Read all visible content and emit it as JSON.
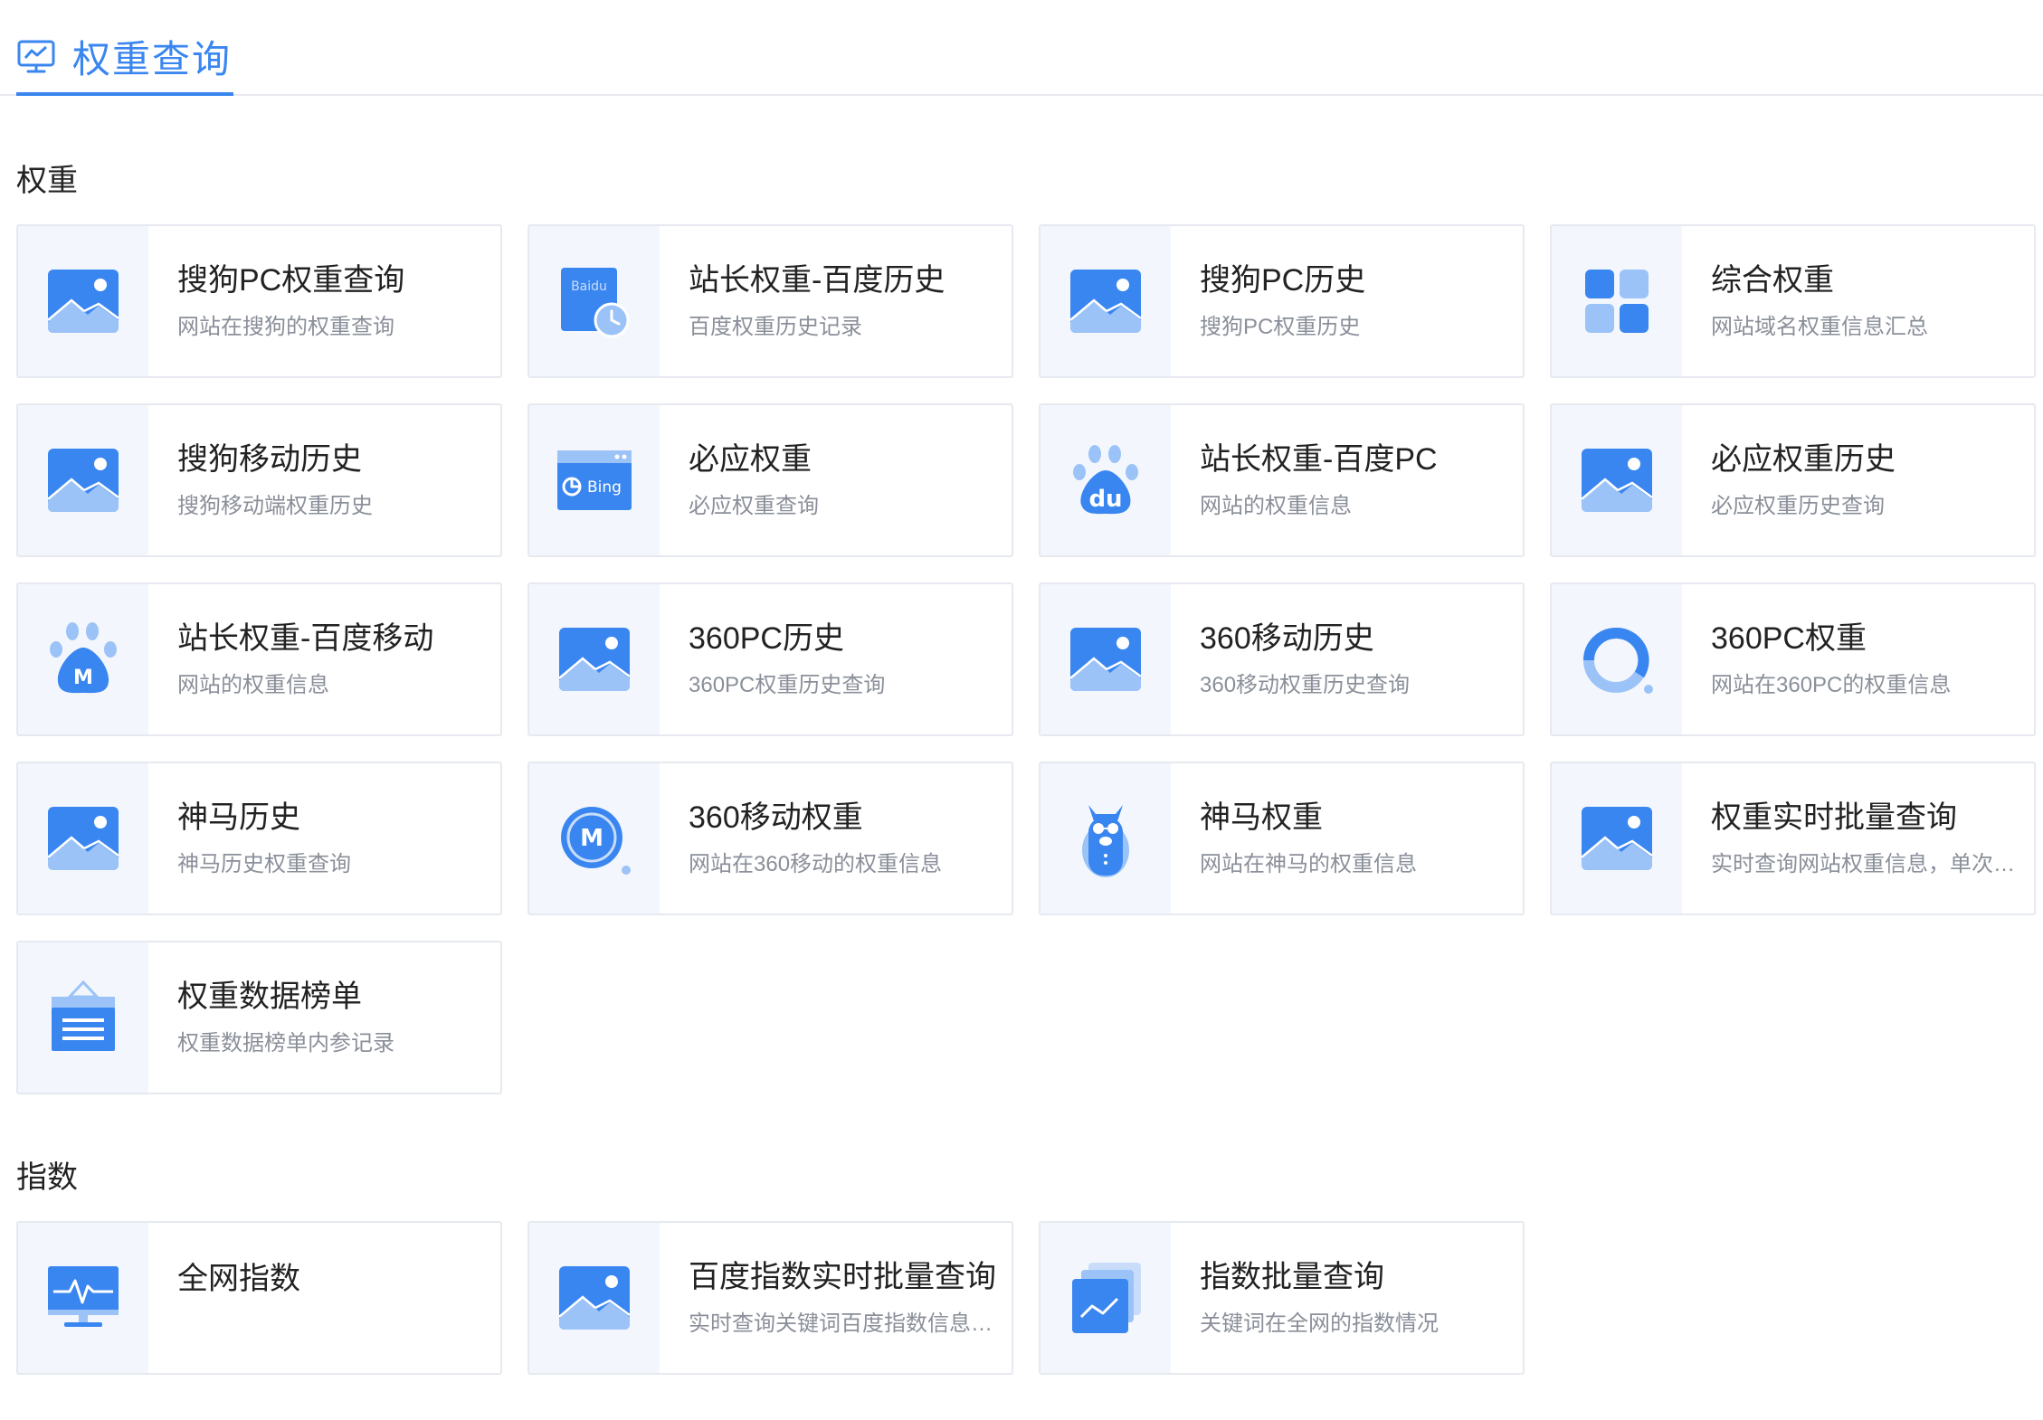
{
  "header": {
    "title": "权重查询",
    "icon": "monitor-chart-icon",
    "accent": "#3a86f0"
  },
  "sections": [
    {
      "title": "权重",
      "cards": [
        {
          "title": "搜狗PC权重查询",
          "desc": "网站在搜狗的权重查询",
          "icon": "image-icon"
        },
        {
          "title": "站长权重-百度历史",
          "desc": "百度权重历史记录",
          "icon": "baidu-history-icon",
          "icon_text": "Baidu"
        },
        {
          "title": "搜狗PC历史",
          "desc": "搜狗PC权重历史",
          "icon": "image-icon"
        },
        {
          "title": "综合权重",
          "desc": "网站域名权重信息汇总",
          "icon": "grid-apps-icon"
        },
        {
          "title": "搜狗移动历史",
          "desc": "搜狗移动端权重历史",
          "icon": "image-icon"
        },
        {
          "title": "必应权重",
          "desc": "必应权重查询",
          "icon": "bing-window-icon",
          "icon_text": "Bing"
        },
        {
          "title": "站长权重-百度PC",
          "desc": "网站的权重信息",
          "icon": "baidu-paw-icon",
          "icon_text": "du"
        },
        {
          "title": "必应权重历史",
          "desc": "必应权重历史查询",
          "icon": "image-icon"
        },
        {
          "title": "站长权重-百度移动",
          "desc": "网站的权重信息",
          "icon": "baidu-mobile-paw-icon",
          "icon_text": "M"
        },
        {
          "title": "360PC历史",
          "desc": "360PC权重历史查询",
          "icon": "image-icon"
        },
        {
          "title": "360移动历史",
          "desc": "360移动权重历史查询",
          "icon": "image-icon"
        },
        {
          "title": "360PC权重",
          "desc": "网站在360PC的权重信息",
          "icon": "360-ring-icon"
        },
        {
          "title": "神马历史",
          "desc": "神马历史权重查询",
          "icon": "image-icon"
        },
        {
          "title": "360移动权重",
          "desc": "网站在360移动的权重信息",
          "icon": "360-mobile-icon",
          "icon_text": "M"
        },
        {
          "title": "神马权重",
          "desc": "网站在神马的权重信息",
          "icon": "shenma-alpaca-icon"
        },
        {
          "title": "权重实时批量查询",
          "desc": "实时查询网站权重信息，单次查询",
          "icon": "image-icon"
        },
        {
          "title": "权重数据榜单",
          "desc": "权重数据榜单内参记录",
          "icon": "ranking-board-icon"
        }
      ]
    },
    {
      "title": "指数",
      "cards": [
        {
          "title": "全网指数",
          "desc": "",
          "icon": "monitor-pulse-icon"
        },
        {
          "title": "百度指数实时批量查询",
          "desc": "实时查询关键词百度指数信息，单次查询",
          "icon": "image-icon"
        },
        {
          "title": "指数批量查询",
          "desc": "关键词在全网的指数情况",
          "icon": "stacked-chart-icon"
        }
      ]
    }
  ]
}
